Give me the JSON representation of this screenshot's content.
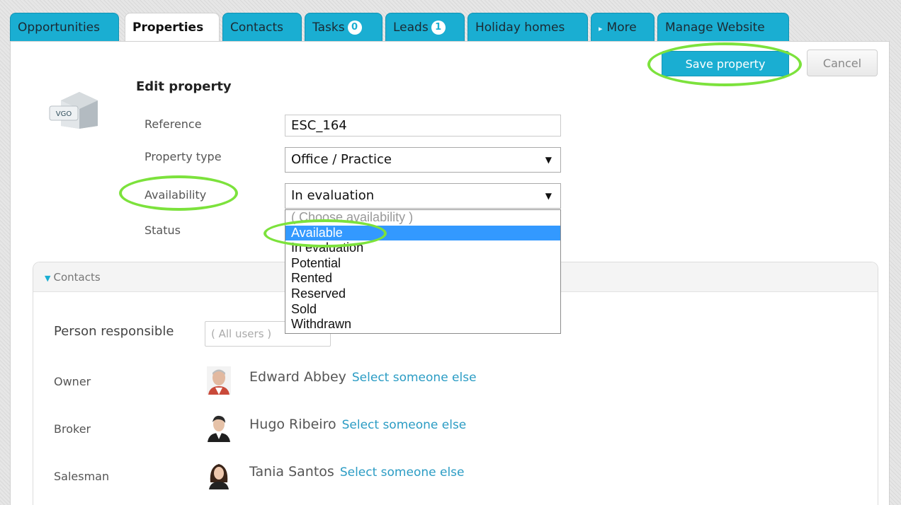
{
  "tabs": [
    {
      "label": "Opportunities"
    },
    {
      "label": "Properties"
    },
    {
      "label": "Contacts"
    },
    {
      "label": "Tasks",
      "badge": "0"
    },
    {
      "label": "Leads",
      "badge": "1"
    },
    {
      "label": "Holiday homes"
    },
    {
      "label": "More"
    },
    {
      "label": "Manage Website"
    }
  ],
  "actions": {
    "save": "Save property",
    "cancel": "Cancel"
  },
  "form": {
    "heading": "Edit property",
    "reference_label": "Reference",
    "reference_value": "ESC_164",
    "property_type_label": "Property type",
    "property_type_value": "Office / Practice",
    "availability_label": "Availability",
    "availability_value": "In evaluation",
    "status_label": "Status"
  },
  "availability_options": [
    "( Choose availability )",
    "Available",
    "In evaluation",
    "Potential",
    "Rented",
    "Reserved",
    "Sold",
    "Withdrawn"
  ],
  "icons": {
    "property": "house-icon",
    "logo_text": "VGO"
  },
  "contacts": {
    "title": "Contacts",
    "person_responsible_label": "Person responsible",
    "person_responsible_placeholder": "( All users )",
    "select_link": "Select someone else",
    "owner_label": "Owner",
    "owner_name": "Edward Abbey",
    "broker_label": "Broker",
    "broker_name": "Hugo Ribeiro",
    "salesman_label": "Salesman",
    "salesman_name": "Tania Santos"
  },
  "colors": {
    "accent": "#1aaed2",
    "highlight": "#7ce23c",
    "selected": "#3399ff"
  }
}
